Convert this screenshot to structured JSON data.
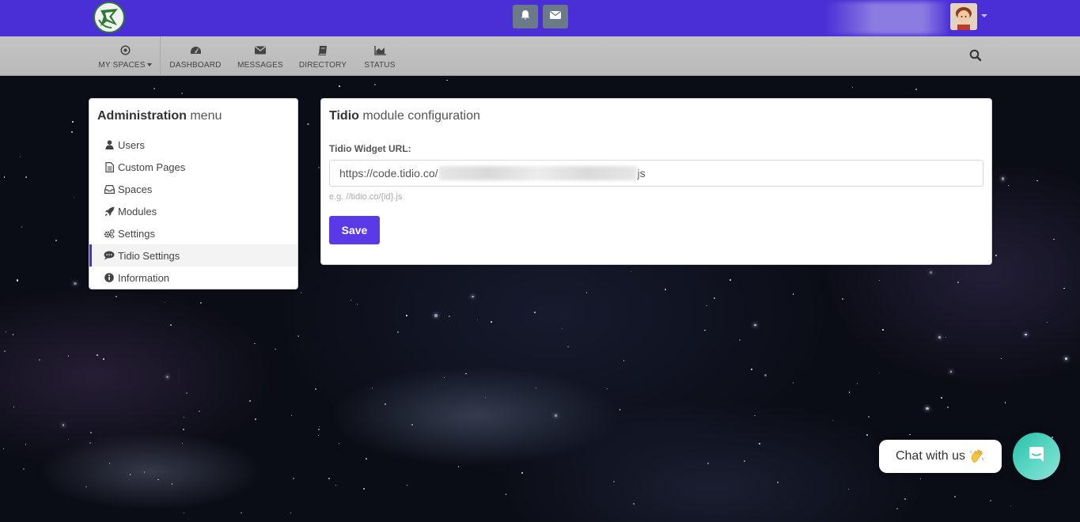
{
  "topbar": {
    "logo_icon": "site-logo",
    "notifications_icon": "bell-icon",
    "messages_icon": "envelope-icon",
    "avatar_icon": "user-avatar"
  },
  "nav": {
    "items": [
      {
        "label": "MY SPACES",
        "icon": "target-icon",
        "dropdown": true
      },
      {
        "label": "DASHBOARD",
        "icon": "dashboard-icon"
      },
      {
        "label": "MESSAGES",
        "icon": "envelope-icon"
      },
      {
        "label": "DIRECTORY",
        "icon": "book-icon"
      },
      {
        "label": "STATUS",
        "icon": "area-chart-icon"
      }
    ],
    "search_icon": "search-icon"
  },
  "admin_menu": {
    "title_bold": "Administration",
    "title_rest": " menu",
    "items": [
      {
        "label": "Users",
        "icon": "user-icon"
      },
      {
        "label": "Custom Pages",
        "icon": "file-icon"
      },
      {
        "label": "Spaces",
        "icon": "inbox-icon"
      },
      {
        "label": "Modules",
        "icon": "rocket-icon"
      },
      {
        "label": "Settings",
        "icon": "cogs-icon"
      },
      {
        "label": "Tidio Settings",
        "icon": "comment-icon",
        "active": true
      },
      {
        "label": "Information",
        "icon": "info-circle-icon"
      }
    ]
  },
  "config": {
    "title_bold": "Tidio",
    "title_rest": " module configuration",
    "field_label": "Tidio Widget URL:",
    "url_prefix": "https://code.tidio.co/",
    "url_suffix": "js",
    "hint": "e.g. //tidio.co/{id}.js",
    "save_label": "Save"
  },
  "chat_widget": {
    "bubble_text": "Chat with us",
    "wave_icon": "waving-hand-icon",
    "launcher_icon": "chat-icon"
  },
  "colors": {
    "topbar": "#4a2ed6",
    "accent": "#5a3ae6",
    "chat_launcher": "#24c0a8"
  }
}
